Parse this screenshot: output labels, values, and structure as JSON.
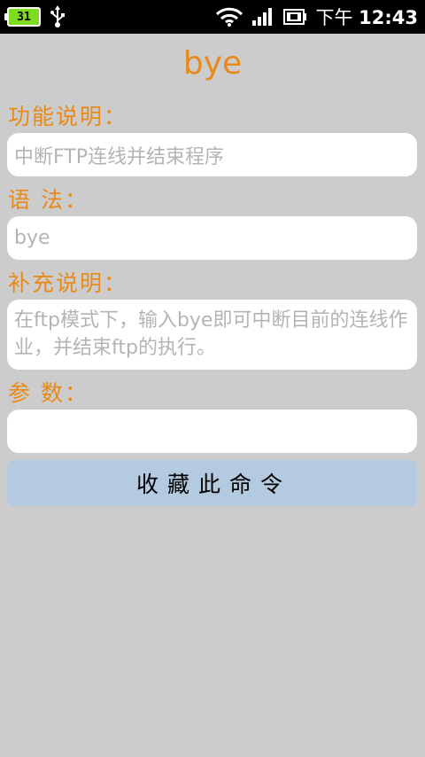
{
  "status_bar": {
    "notification_badge": "31",
    "time_prefix": "下午",
    "time": "12:43",
    "icons": [
      "usb-icon",
      "wifi-icon",
      "signal-icon",
      "battery-icon"
    ]
  },
  "header": {
    "title": "bye"
  },
  "fields": {
    "function_desc": {
      "label": "功能说明：",
      "value": "中断FTP连线并结束程序"
    },
    "syntax": {
      "label": "语 法：",
      "value": "bye"
    },
    "supplement": {
      "label": "补充说明：",
      "value": "在ftp模式下，输入bye即可中断目前的连线作业，并结束ftp的执行。"
    },
    "params": {
      "label": "参 数：",
      "value": ""
    }
  },
  "actions": {
    "favorite_label": "收藏此命令"
  },
  "colors": {
    "accent": "#e88a1a",
    "background": "#cccccc",
    "button": "#b3cae0",
    "placeholder_text": "#b4b4b4"
  }
}
